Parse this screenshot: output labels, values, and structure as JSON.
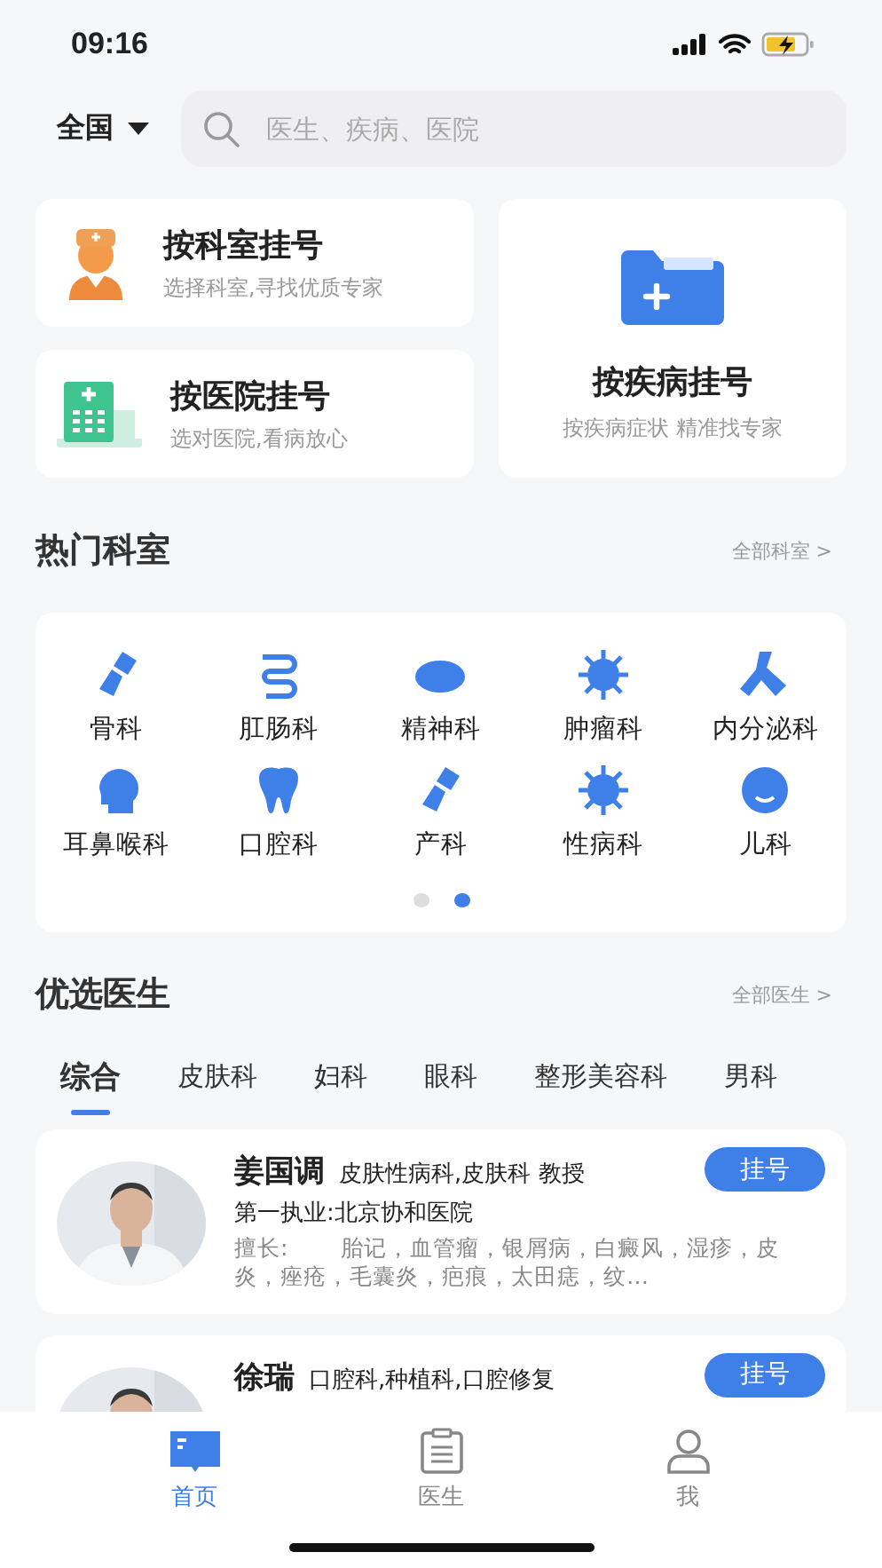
{
  "status_bar": {
    "time": "09:16"
  },
  "location": {
    "label": "全国"
  },
  "search": {
    "placeholder": "医生、疾病、医院"
  },
  "booking_cards": [
    {
      "kind": "department",
      "title": "按科室挂号",
      "subtitle": "选择科室,寻找优质专家"
    },
    {
      "kind": "hospital",
      "title": "按医院挂号",
      "subtitle": "选对医院,看病放心"
    },
    {
      "kind": "disease",
      "title": "按疾病挂号",
      "subtitle": "按疾病症状 精准找专家"
    }
  ],
  "hot_departments": {
    "title": "热门科室",
    "more": "全部科室 >",
    "items": [
      {
        "label": "骨科"
      },
      {
        "label": "肛肠科"
      },
      {
        "label": "精神科"
      },
      {
        "label": "肿瘤科"
      },
      {
        "label": "内分泌科"
      },
      {
        "label": "耳鼻喉科"
      },
      {
        "label": "口腔科"
      },
      {
        "label": "产科"
      },
      {
        "label": "性病科"
      },
      {
        "label": "儿科"
      }
    ],
    "pages": [
      {
        "selected": false
      },
      {
        "selected": true
      }
    ]
  },
  "doctors": {
    "title": "优选医生",
    "more": "全部医生 >",
    "tabs": [
      {
        "label": "综合",
        "selected": true
      },
      {
        "label": "皮肤科",
        "selected": false
      },
      {
        "label": "妇科",
        "selected": false
      },
      {
        "label": "眼科",
        "selected": false
      },
      {
        "label": "整形美容科",
        "selected": false
      },
      {
        "label": "男科",
        "selected": false
      }
    ],
    "list": [
      {
        "name": "姜国调",
        "title": "皮肤性病科,皮肤科 教授",
        "hospital": "第一执业:北京协和医院",
        "expertise": "擅长:　　 胎记，血管瘤，银屑病，白癜风，湿疹，皮炎，痤疮，毛囊炎，疤痕，太田痣，纹…",
        "button": "挂号"
      },
      {
        "name": "徐瑞",
        "title": "口腔科,种植科,口腔修复",
        "button": "挂号"
      }
    ]
  },
  "tab_bar": [
    {
      "label": "首页",
      "selected": true
    },
    {
      "label": "医生",
      "selected": false
    },
    {
      "label": "我",
      "selected": false
    }
  ]
}
